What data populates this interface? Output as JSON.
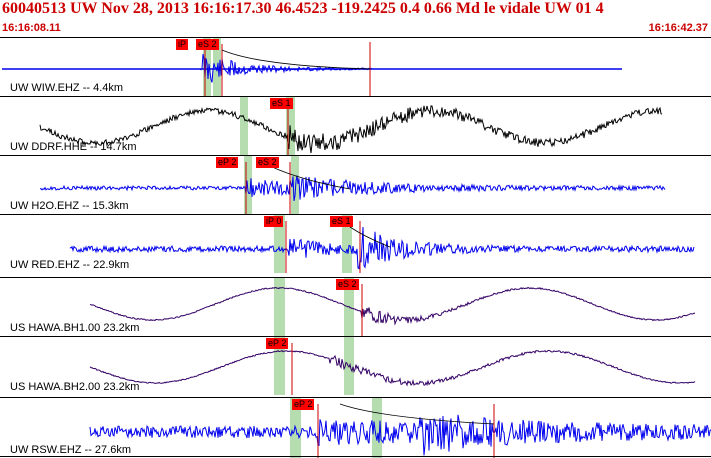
{
  "header": {
    "title": "60040513 UW Nov 28, 2013 16:16:17.30    46.4523 -119.2425  0.4 0.66 Md le vidale UW 01    4",
    "start_time": "16:16:08.11",
    "end_time": "16:16:42.37"
  },
  "colors": {
    "blue_trace": "#0000ee",
    "black_trace": "#000000",
    "purple_trace": "#330066",
    "pick_flag": "#ff0000",
    "window_band": "#b5ddb0",
    "title_red": "#cc0000"
  },
  "traces": [
    {
      "label": "UW WIW.EHZ -- 4.4km",
      "picks": [
        "iP",
        "eS 2"
      ]
    },
    {
      "label": "UW DDRF.HHE -- 14.7km",
      "picks": [
        "eS 1"
      ]
    },
    {
      "label": "UW H2O.EHZ -- 15.3km",
      "picks": [
        "eP 2",
        "eS 2"
      ]
    },
    {
      "label": "UW RED.EHZ -- 22.9km",
      "picks": [
        "iP 0",
        "eS 1"
      ]
    },
    {
      "label": "US HAWA.BH1.00 23.2km",
      "picks": [
        "eS 2"
      ]
    },
    {
      "label": "US HAWA.BH2.00 23.2km",
      "picks": [
        "eP 2"
      ]
    },
    {
      "label": "UW RSW.EHZ -- 27.6km",
      "picks": [
        "eP 2"
      ]
    }
  ]
}
